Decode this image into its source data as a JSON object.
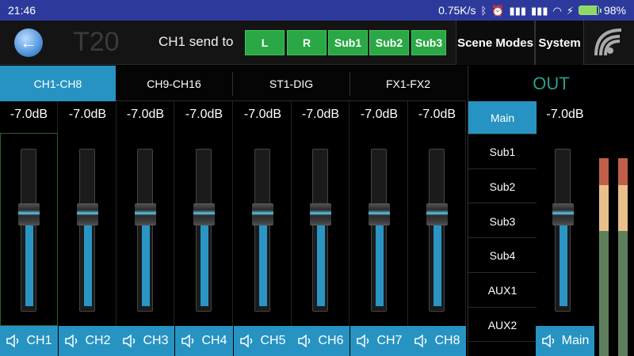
{
  "status": {
    "time": "21:46",
    "network_speed": "0.75K/s",
    "battery": "98%"
  },
  "header": {
    "app_title": "T20",
    "send_label": "CH1 send to",
    "send_buttons": [
      "L",
      "R",
      "Sub1",
      "Sub2",
      "Sub3"
    ],
    "scene_modes": "Scene Modes",
    "system": "System"
  },
  "tabs": [
    "CH1-CH8",
    "CH9-CH16",
    "ST1-DIG",
    "FX1-FX2"
  ],
  "active_tab": 0,
  "out_title": "OUT",
  "channels": [
    {
      "label": "CH1",
      "db": "-7.0dB",
      "level": 0.62
    },
    {
      "label": "CH2",
      "db": "-7.0dB",
      "level": 0.62
    },
    {
      "label": "CH3",
      "db": "-7.0dB",
      "level": 0.62
    },
    {
      "label": "CH4",
      "db": "-7.0dB",
      "level": 0.62
    },
    {
      "label": "CH5",
      "db": "-7.0dB",
      "level": 0.62
    },
    {
      "label": "CH6",
      "db": "-7.0dB",
      "level": 0.62
    },
    {
      "label": "CH7",
      "db": "-7.0dB",
      "level": 0.62
    },
    {
      "label": "CH8",
      "db": "-7.0dB",
      "level": 0.62
    }
  ],
  "selected_channel": 0,
  "outputs": [
    "Main",
    "Sub1",
    "Sub2",
    "Sub3",
    "Sub4",
    "AUX1",
    "AUX2"
  ],
  "active_output": 0,
  "main": {
    "label": "Main",
    "db": "-7.0dB",
    "level": 0.62
  },
  "colors": {
    "accent": "#2793c2",
    "send_green": "#2aa845",
    "out_teal": "#2a9e8f",
    "meter_red": "#c0604a",
    "meter_amber": "#e9c08c",
    "meter_green": "#5f7f5c"
  },
  "icons": {
    "back": "back-arrow-icon",
    "wifi": "wifi-icon",
    "speaker": "speaker-icon"
  }
}
